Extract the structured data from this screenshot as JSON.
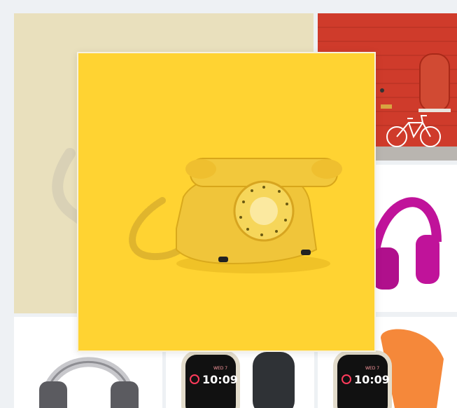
{
  "gallery": {
    "lightbox_image": "yellow rotary telephone",
    "tiles": [
      {
        "subject": "yellow rotary telephone (dimmed background)"
      },
      {
        "subject": "red brick wall with white bicycle"
      },
      {
        "subject": "magenta over-ear headphones"
      },
      {
        "subject": "silver over-ear headphones"
      },
      {
        "subject": "smartwatch with dark band"
      },
      {
        "subject": "smartwatch with orange band"
      }
    ]
  },
  "watch_faces": [
    {
      "day": "WED 7",
      "time": "10:09"
    },
    {
      "day": "WED 7",
      "time": "10:09"
    }
  ],
  "colors": {
    "page_bg": "#eef1f4",
    "lightbox_bg": "#ffd332",
    "beige_tile": "#e9e0bd",
    "brick_red": "#cf3b2b",
    "headphones_magenta": "#c0139a",
    "watch_orange": "#f5883a"
  }
}
